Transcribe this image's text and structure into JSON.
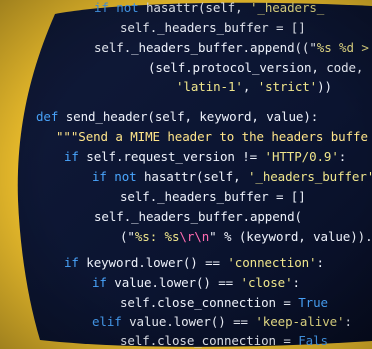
{
  "photo": {
    "colors": {
      "background": "#f6c62e",
      "screen": "#0b1430",
      "keyword": "#4aa6ff",
      "identifier": "#eef2fb",
      "string": "#f0e68c",
      "docstring": "#ffe58a",
      "escape": "#ff6bb0"
    },
    "code_lines": [
      [
        {
          "t": "if",
          "c": "kw"
        },
        {
          "t": " "
        },
        {
          "t": "not",
          "c": "kw"
        },
        {
          "t": " hasattr(self, "
        },
        {
          "t": "'_headers_",
          "c": "str"
        }
      ],
      [
        {
          "t": "self._headers_buffer = []"
        }
      ],
      [
        {
          "t": "self._headers_buffer.append((\""
        },
        {
          "t": "%s %d >",
          "c": "str"
        }
      ],
      [
        {
          "t": "(self.protocol_version, code,"
        }
      ],
      [
        {
          "t": "'latin-1'",
          "c": "str"
        },
        {
          "t": ", "
        },
        {
          "t": "'strict'",
          "c": "str"
        },
        {
          "t": "))"
        }
      ],
      [
        {
          "t": ""
        }
      ],
      [
        {
          "t": "def",
          "c": "kw"
        },
        {
          "t": " "
        },
        {
          "t": "send_header",
          "c": "fn"
        },
        {
          "t": "(self, keyword, value):"
        }
      ],
      [
        {
          "t": "\"\"\"Send a MIME header to the headers buffe",
          "c": "doc"
        }
      ],
      [
        {
          "t": "if",
          "c": "kw"
        },
        {
          "t": " self.request_version != "
        },
        {
          "t": "'HTTP/0.9'",
          "c": "str"
        },
        {
          "t": ":"
        }
      ],
      [
        {
          "t": "if",
          "c": "kw"
        },
        {
          "t": " "
        },
        {
          "t": "not",
          "c": "kw"
        },
        {
          "t": " hasattr(self, "
        },
        {
          "t": "'_headers_buffer'",
          "c": "str"
        },
        {
          "t": ")"
        }
      ],
      [
        {
          "t": "self._headers_buffer = []"
        }
      ],
      [
        {
          "t": "self._headers_buffer.append("
        }
      ],
      [
        {
          "t": "(\""
        },
        {
          "t": "%s: %s",
          "c": "str"
        },
        {
          "t": "\\r\\n",
          "c": "esc"
        },
        {
          "t": "\""
        },
        {
          "t": " % (keyword, value))."
        }
      ],
      [
        {
          "t": ""
        }
      ],
      [
        {
          "t": "if",
          "c": "kw"
        },
        {
          "t": " keyword.lower() == "
        },
        {
          "t": "'connection'",
          "c": "str"
        },
        {
          "t": ":"
        }
      ],
      [
        {
          "t": "if",
          "c": "kw"
        },
        {
          "t": " value.lower() == "
        },
        {
          "t": "'close'",
          "c": "str"
        },
        {
          "t": ":"
        }
      ],
      [
        {
          "t": "self.close_connection = "
        },
        {
          "t": "True",
          "c": "kw"
        }
      ],
      [
        {
          "t": "elif",
          "c": "kw"
        },
        {
          "t": " value.lower() == "
        },
        {
          "t": "'keep-alive'",
          "c": "str"
        },
        {
          "t": ":"
        }
      ],
      [
        {
          "t": "self.close_connection = "
        },
        {
          "t": "Fals",
          "c": "kw"
        }
      ]
    ]
  }
}
